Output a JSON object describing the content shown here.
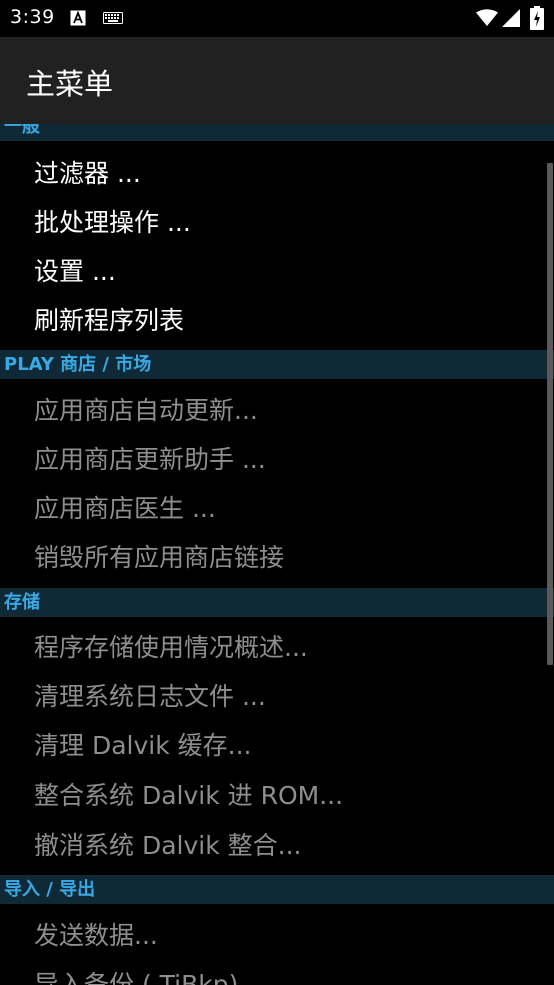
{
  "status_bar": {
    "time": "3:39",
    "icons": [
      "font-a-icon",
      "keyboard-icon",
      "wifi-icon",
      "signal-icon",
      "battery-icon"
    ]
  },
  "app_bar": {
    "title": "主菜单"
  },
  "sections": {
    "general": {
      "header": "一般",
      "items": [
        "过滤器 ...",
        "批处理操作 ...",
        "设置 ...",
        "刷新程序列表"
      ]
    },
    "play_store": {
      "header": "PLAY 商店 / 市场",
      "items": [
        "应用商店自动更新...",
        "应用商店更新助手 ...",
        "应用商店医生 ...",
        "销毁所有应用商店链接"
      ]
    },
    "storage": {
      "header": "存储",
      "items": [
        "程序存储使用情况概述...",
        "清理系统日志文件 ...",
        "清理 Dalvik 缓存...",
        "整合系统 Dalvik 进 ROM...",
        "撤消系统 Dalvik 整合..."
      ]
    },
    "import_export": {
      "header": "导入 / 导出",
      "items": [
        "发送数据...",
        "导入备份 ( TiBkp)"
      ]
    }
  },
  "colors": {
    "section_header_bg": "#0f2a36",
    "section_header_text": "#39a9e6",
    "app_bar_bg": "#212121",
    "disabled_text": "#8e8e8e"
  }
}
